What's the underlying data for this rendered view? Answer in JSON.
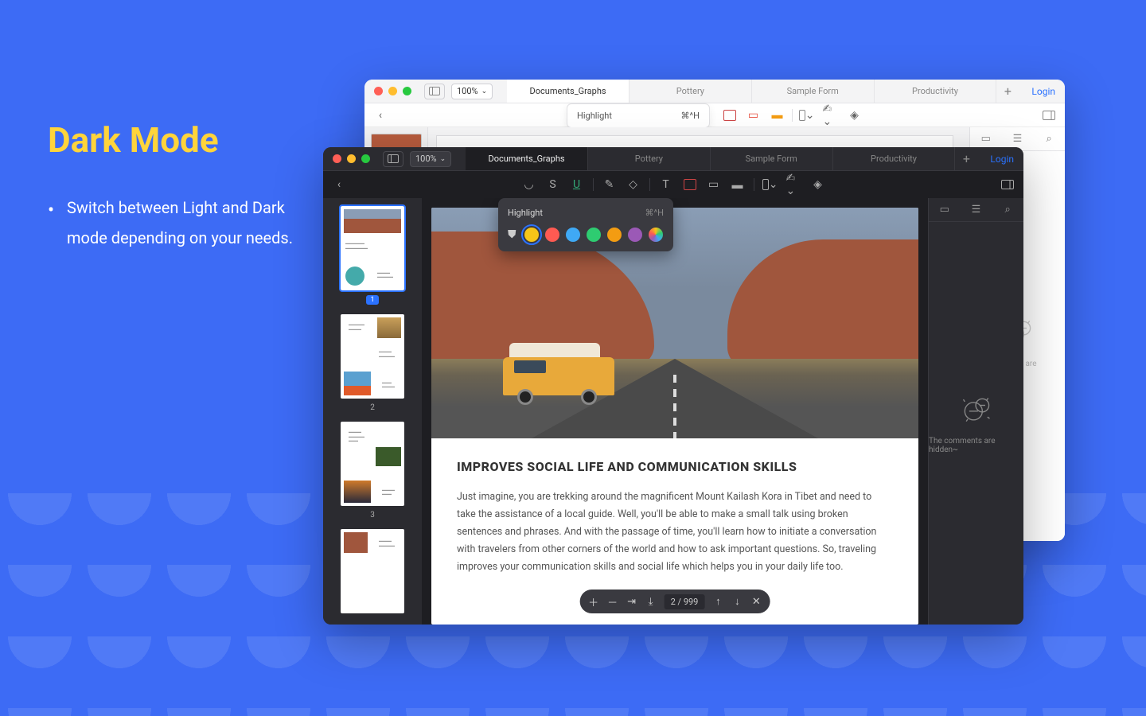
{
  "marketing": {
    "title": "Dark Mode",
    "bullet": "Switch between Light and Dark mode depending on your needs."
  },
  "tabs": [
    "Documents_Graphs",
    "Pottery",
    "Sample Form",
    "Productivity"
  ],
  "zoom": "100%",
  "login": "Login",
  "popover": {
    "title": "Highlight",
    "shortcut": "⌘^H"
  },
  "highlight_colors": [
    "#f5c518",
    "#ff5a52",
    "#3fa9f5",
    "#2ecc71",
    "#f39c12",
    "#9b59b6",
    "#ff4fa3"
  ],
  "comments_hidden": "The comments are hidden~",
  "thumbs": {
    "pages": [
      "1",
      "2",
      "3"
    ]
  },
  "pager": {
    "current": "2",
    "total": "999"
  },
  "article": {
    "heading": "IMPROVES SOCIAL LIFE AND COMMUNICATION SKILLS",
    "body": "Just imagine, you are trekking around the magnificent Mount Kailash Kora in Tibet and need to take the assistance of a local guide. Well, you'll be able to make a small talk using broken sentences and phrases. And with the passage of time, you'll learn how to initiate a conversation with travelers from other corners of the world and how to ask important questions. So, traveling improves your communication skills and social life which helps you in your daily life too."
  }
}
